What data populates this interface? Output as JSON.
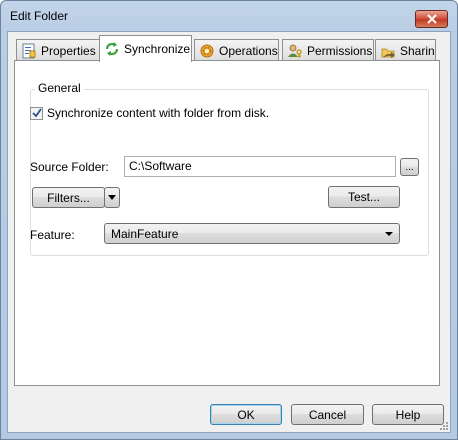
{
  "window": {
    "title": "Edit Folder"
  },
  "tabs": [
    {
      "label": "Properties",
      "icon": "properties-icon",
      "active": false
    },
    {
      "label": "Synchronize",
      "icon": "sync-icon",
      "active": true
    },
    {
      "label": "Operations",
      "icon": "gear-icon",
      "active": false
    },
    {
      "label": "Permissions",
      "icon": "users-key-icon",
      "active": false
    },
    {
      "label": "Sharing",
      "icon": "sharing-icon",
      "active": false
    }
  ],
  "synchronize": {
    "group_label": "General",
    "checkbox_label": "Synchronize content with folder from disk.",
    "checkbox_checked": true,
    "source_folder_label": "Source Folder:",
    "source_folder_value": "C:\\Software",
    "browse_label": "...",
    "filters_label": "Filters...",
    "test_label": "Test...",
    "feature_label": "Feature:",
    "feature_value": "MainFeature"
  },
  "footer": {
    "ok_label": "OK",
    "cancel_label": "Cancel",
    "help_label": "Help"
  },
  "colors": {
    "close_button": "#c7432b",
    "default_button_border": "#3c7fb1",
    "window_frame": "#b9cde4"
  }
}
